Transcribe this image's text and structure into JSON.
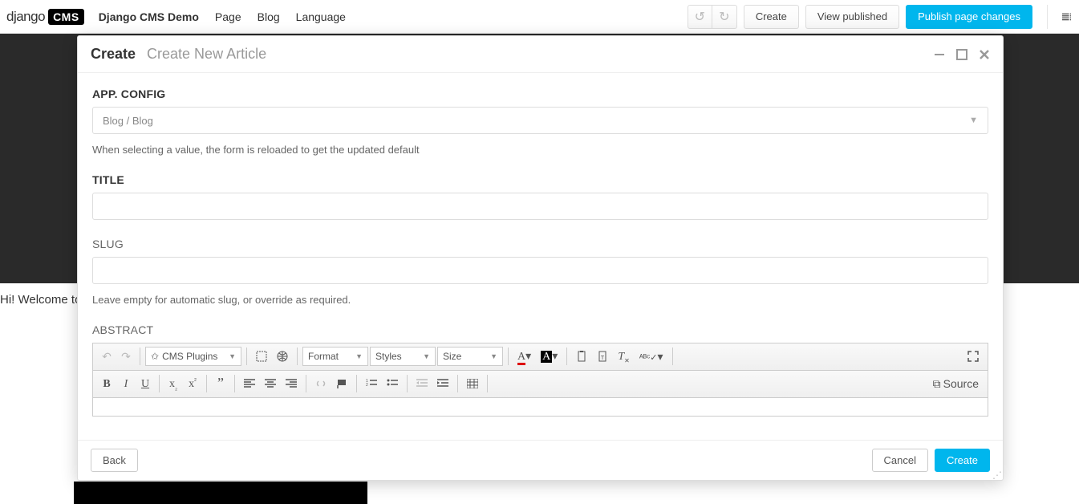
{
  "topbar": {
    "logo_prefix": "django",
    "logo_box": "CMS",
    "site_title": "Django CMS Demo",
    "nav": {
      "page": "Page",
      "blog": "Blog",
      "language": "Language"
    },
    "create": "Create",
    "view_published": "View published",
    "publish": "Publish page changes"
  },
  "background": {
    "welcome": "Hi! Welcome to"
  },
  "modal": {
    "title": "Create",
    "subtitle": "Create New Article",
    "fields": {
      "app_config": {
        "label": "App. Config",
        "value": "Blog / Blog",
        "help": "When selecting a value, the form is reloaded to get the updated default"
      },
      "title": {
        "label": "Title",
        "value": ""
      },
      "slug": {
        "label": "Slug",
        "value": "",
        "help": "Leave empty for automatic slug, or override as required."
      },
      "abstract": {
        "label": "Abstract"
      }
    },
    "rte": {
      "cms_plugins": "CMS Plugins",
      "format": "Format",
      "styles": "Styles",
      "size": "Size",
      "source": "Source"
    },
    "footer": {
      "back": "Back",
      "cancel": "Cancel",
      "create": "Create"
    }
  }
}
